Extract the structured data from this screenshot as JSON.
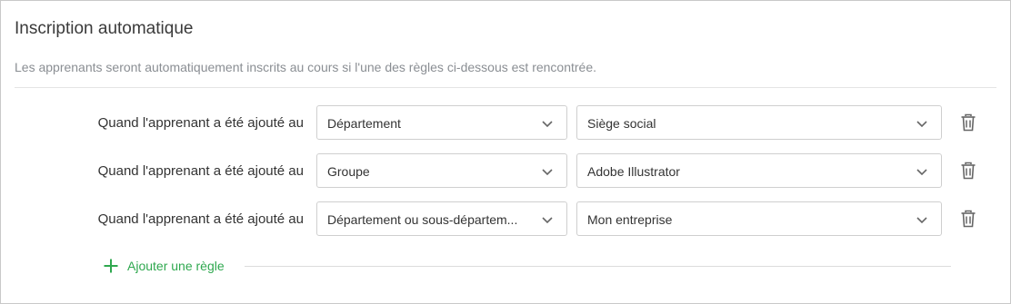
{
  "section": {
    "title": "Inscription automatique",
    "description": "Les apprenants seront automatiquement inscrits au cours si l'une des règles ci-dessous est rencontrée."
  },
  "rules": [
    {
      "label": "Quand l'apprenant a été ajouté au",
      "type": "Département",
      "value": "Siège social"
    },
    {
      "label": "Quand l'apprenant a été ajouté au",
      "type": "Groupe",
      "value": "Adobe Illustrator"
    },
    {
      "label": "Quand l'apprenant a été ajouté au",
      "type": "Département ou sous-départem...",
      "value": "Mon entreprise"
    }
  ],
  "add_rule": {
    "label": "Ajouter une règle",
    "icon": "plus-icon"
  },
  "icons": {
    "dropdown": "chevron-down-icon",
    "delete": "trash-icon"
  },
  "colors": {
    "accent": "#2fa84f",
    "muted_text": "#8a8e93",
    "border": "#cfcfcf"
  }
}
